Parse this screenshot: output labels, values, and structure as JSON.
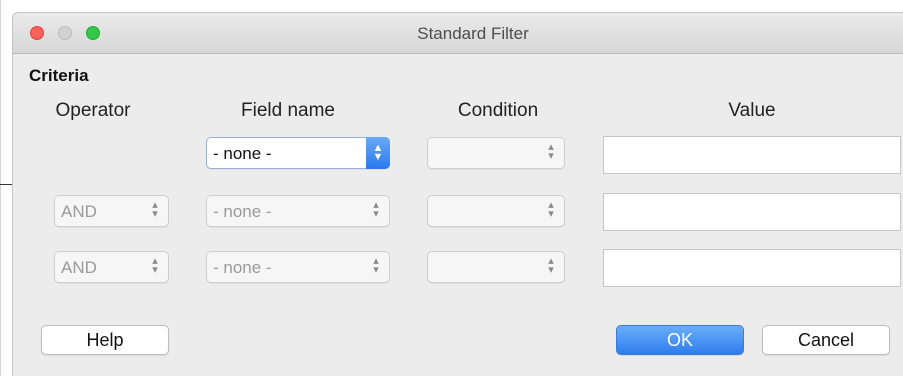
{
  "window": {
    "title": "Standard Filter"
  },
  "criteria": {
    "label": "Criteria",
    "headers": {
      "operator": "Operator",
      "field_name": "Field name",
      "condition": "Condition",
      "value": "Value"
    },
    "rows": [
      {
        "operator": "",
        "field_name": "- none -",
        "condition": "",
        "value": ""
      },
      {
        "operator": "AND",
        "field_name": "- none -",
        "condition": "",
        "value": ""
      },
      {
        "operator": "AND",
        "field_name": "- none -",
        "condition": "",
        "value": ""
      }
    ]
  },
  "buttons": {
    "help": "Help",
    "ok": "OK",
    "cancel": "Cancel"
  },
  "icons": {
    "stepper": "up-down-chevron-icon",
    "window_close": "close-dot-icon",
    "window_minimize": "minimize-dot-icon",
    "window_maximize": "maximize-dot-icon"
  },
  "colors": {
    "accent": "#2f7dee",
    "close": "#fc605c",
    "maximize": "#34c84a",
    "dialog_bg": "#ececec"
  }
}
